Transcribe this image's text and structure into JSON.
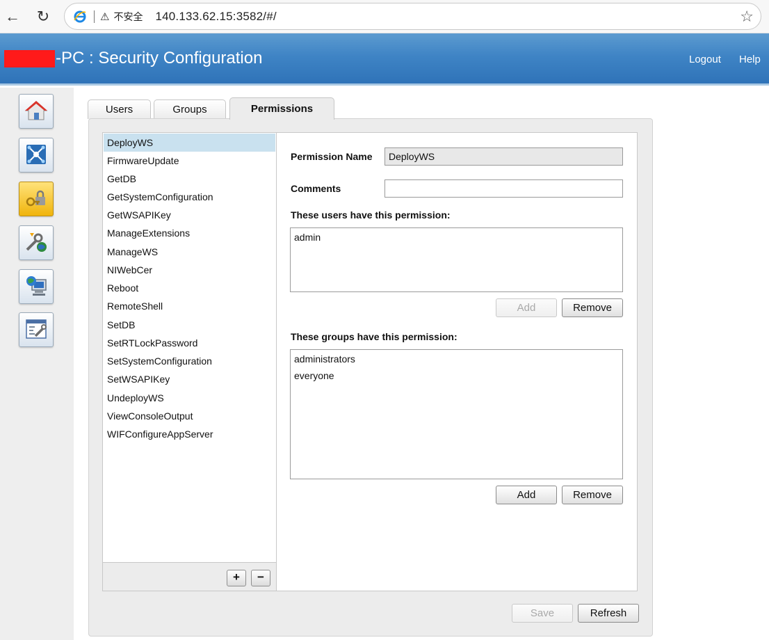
{
  "browser": {
    "security_label": "不安全",
    "url": "140.133.62.15:3582/#/"
  },
  "header": {
    "title": "-PC : Security Configuration",
    "logout": "Logout",
    "help": "Help",
    "bg_color": "#3f84c5"
  },
  "sidebar": {
    "items": [
      {
        "icon": "home-icon"
      },
      {
        "icon": "network-icon"
      },
      {
        "icon": "security-lock-icon",
        "active": true
      },
      {
        "icon": "software-tools-icon"
      },
      {
        "icon": "web-server-icon"
      },
      {
        "icon": "settings-window-icon"
      }
    ]
  },
  "tabs": [
    {
      "label": "Users"
    },
    {
      "label": "Groups"
    },
    {
      "label": "Permissions",
      "active": true
    }
  ],
  "permissions": {
    "selected": "DeployWS",
    "items": [
      "DeployWS",
      "FirmwareUpdate",
      "GetDB",
      "GetSystemConfiguration",
      "GetWSAPIKey",
      "ManageExtensions",
      "ManageWS",
      "NIWebCer",
      "Reboot",
      "RemoteShell",
      "SetDB",
      "SetRTLockPassword",
      "SetSystemConfiguration",
      "SetWSAPIKey",
      "UndeployWS",
      "ViewConsoleOutput",
      "WIFConfigureAppServer"
    ],
    "add_symbol": "+",
    "remove_symbol": "−"
  },
  "details": {
    "permission_name_label": "Permission Name",
    "permission_name_value": "DeployWS",
    "comments_label": "Comments",
    "comments_value": "",
    "users_heading": "These users have this permission:",
    "users": [
      "admin"
    ],
    "users_add": "Add",
    "users_remove": "Remove",
    "groups_heading": "These groups have this permission:",
    "groups": [
      "administrators",
      "everyone"
    ],
    "groups_add": "Add",
    "groups_remove": "Remove"
  },
  "footer": {
    "save": "Save",
    "refresh": "Refresh"
  }
}
